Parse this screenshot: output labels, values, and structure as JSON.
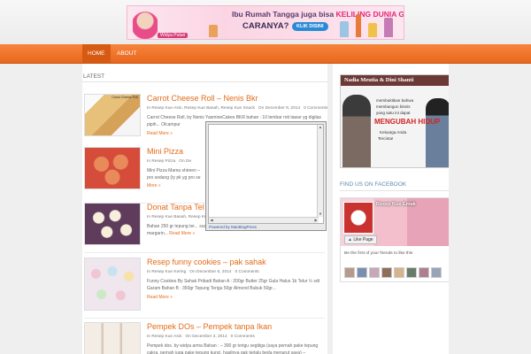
{
  "banner": {
    "line1_start": "Ibu Rumah Tangga juga bisa ",
    "line1_highlight": "KELILING DUNIA GRATIS!",
    "line2": "CARANYA?",
    "cta": "KLIK DISINI",
    "brand": "Widya Putari",
    "colors": {
      "accent": "#e22a78",
      "cta": "#2a8ad6"
    }
  },
  "nav": {
    "items": [
      {
        "label": "HOME",
        "active": true
      },
      {
        "label": "ABOUT",
        "active": false
      }
    ],
    "color": "#f07a2e"
  },
  "main": {
    "section_label": "LATEST",
    "posts": [
      {
        "title": "Carrot Cheese Roll – Nenis Bkr",
        "categories": "In Resep Kue Asin, Resep Kue Basah, Resep Kue Snack",
        "date": "On December 9, 2014",
        "comments": "0 Comments",
        "excerpt": "Carrot Cheese Roll, by Nenis YasmineCakes BKR bahan : 10 lembar roti tawar yg digilas pipih... Olcampur",
        "more": "Read More »",
        "thumb_caption": "Carrot Cheese Roll"
      },
      {
        "title": "Mini Pizza",
        "categories": "In Resep Pizza",
        "date": "On De",
        "comments": "",
        "excerpt": "Mini Pizza Mama shireen – pro sedang (ty pk yg pro se",
        "more": "More »",
        "thumb_caption": ""
      },
      {
        "title": "Donat Tanpa Tel",
        "categories": "In Resep Kue Basah, Resep Kue Snack",
        "date": "On December 7, 2014",
        "comments": "",
        "excerpt": "Bahan 250 gr tepung ter... susu bubuk vanilla 30 gr gula pasir  ...",
        "more": "Read More »",
        "thumb_caption": ""
      },
      {
        "title": "Resep funny cookies – pak sahak",
        "categories": "In Resep Kue Kering",
        "date": "On December 6, 2014",
        "comments": "0 Comments",
        "excerpt": "Funny Cookies By Sahak Pribadi Bahan A : 200gr Butter 25gr Gula Halus 1b Telur ½ sdt Garam Bahan B : 350gr Tepung Terigu 50gr Almond Bubuk 50gr...",
        "more": "Read More »",
        "thumb_caption": ""
      },
      {
        "title": "Pempek DOs – Pempek tanpa Ikan",
        "categories": "In Resep Kue Asin",
        "date": "On December 3, 2014",
        "comments": "0 Comments",
        "excerpt": "Pempek dos. by widya arma Bahan : – 300 gr terigu segitiga (saya pernah pake tepung cakra, pernah juga pake tepung kunci, hasilnya gak terlalu beda menurut saya) –",
        "more": "",
        "thumb_caption": ""
      }
    ],
    "third_post_tail": "80 ml air 25 gr margarin..."
  },
  "sidebar": {
    "ad": {
      "title": "Nadia Meutia & Dini Shanti",
      "line1": "membuktikan bahwa",
      "line2": "membangun bisnis",
      "line3": "yang satu ini dapat",
      "big": "MENGUBAH HIDUP",
      "line4": "Keluarga Anda",
      "line5": "Tercinta!"
    },
    "facebook": {
      "heading": "FIND US ON FACEBOOK",
      "page_name": "Resep Kue Emak",
      "like_label": "Like Page",
      "caption": "Be the first of your friends to like this"
    }
  },
  "popup": {
    "footer": "Powered by MacBlogPress"
  }
}
